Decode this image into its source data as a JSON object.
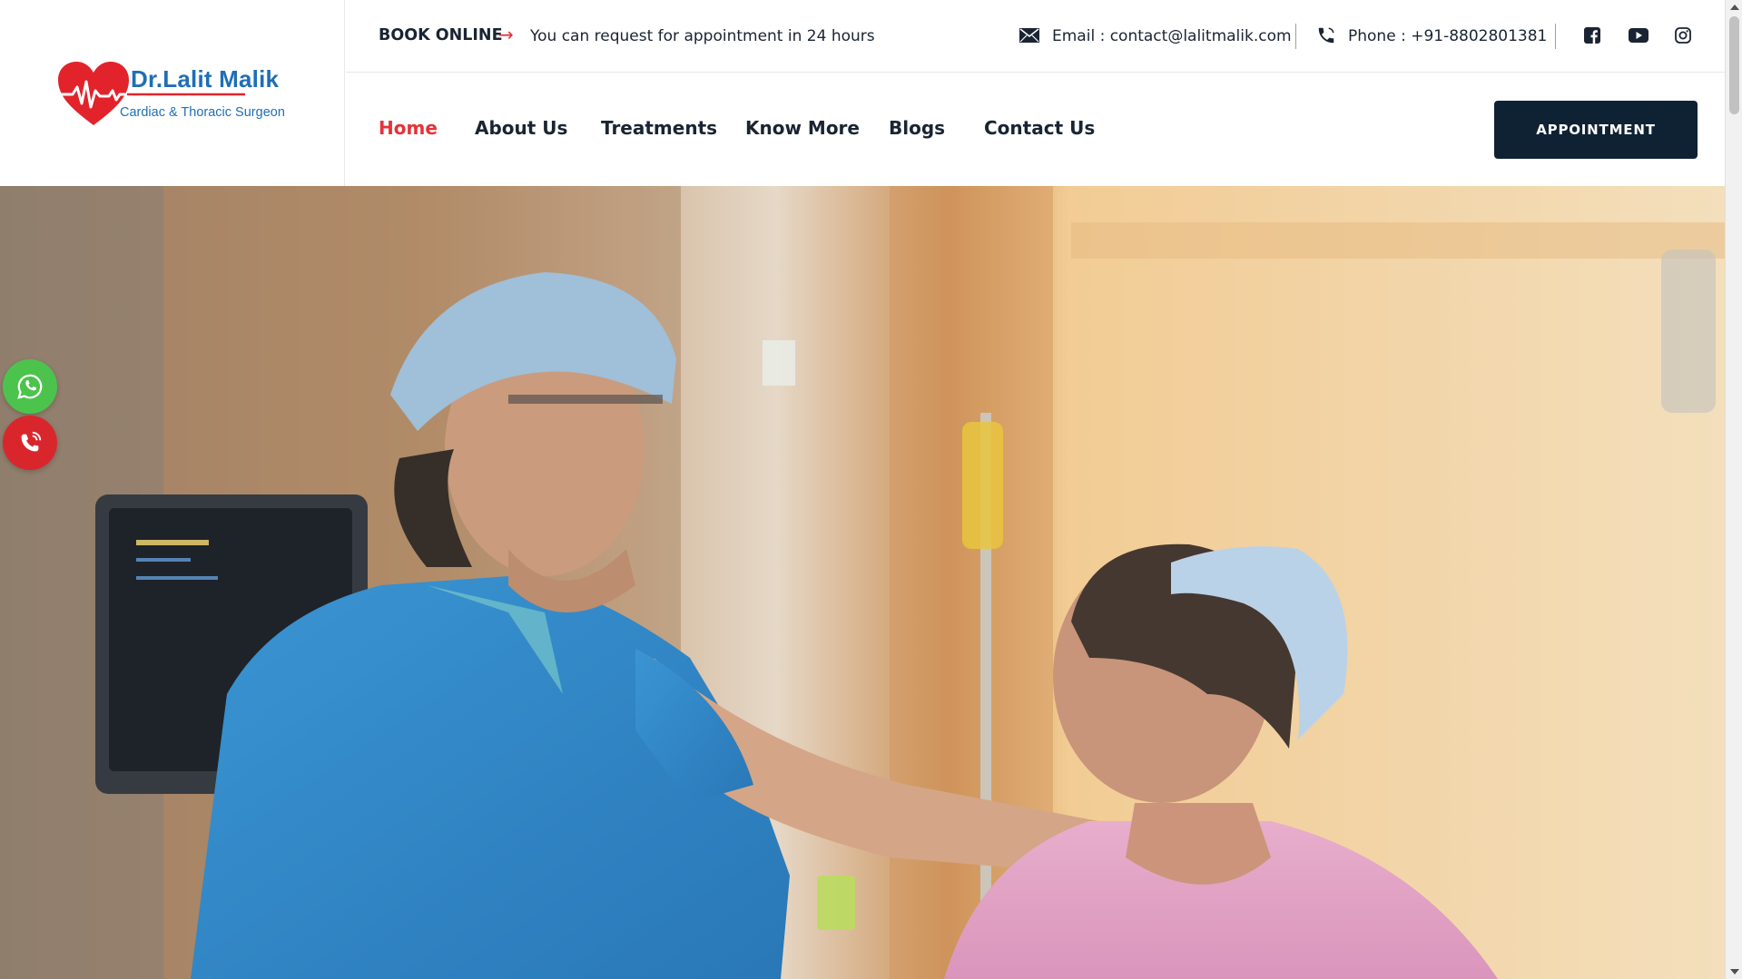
{
  "brand": {
    "name": "Dr.Lalit Malik",
    "subtitle": "Cardiac & Thoracic Surgeon"
  },
  "topbar": {
    "book_label": "BOOK ONLINE",
    "book_arrow": "→",
    "book_text": "You can request for appointment in 24 hours",
    "email": "Email : contact@lalitmalik.com",
    "phone": "Phone : +91-8802801381",
    "social": [
      "facebook-icon",
      "youtube-icon",
      "instagram-icon"
    ]
  },
  "nav": {
    "items": [
      {
        "label": "Home",
        "active": true
      },
      {
        "label": "About Us"
      },
      {
        "label": "Treatments"
      },
      {
        "label": "Know More"
      },
      {
        "label": "Blogs"
      },
      {
        "label": "Contact Us"
      }
    ],
    "cta": "APPOINTMENT"
  },
  "floating": [
    "whatsapp-icon",
    "phone-ring-icon"
  ],
  "colors": {
    "accent": "#e53238",
    "dark": "#0f2233",
    "brand_blue": "#1f6fb5",
    "whatsapp": "#4cc34c",
    "call": "#d9262c"
  }
}
